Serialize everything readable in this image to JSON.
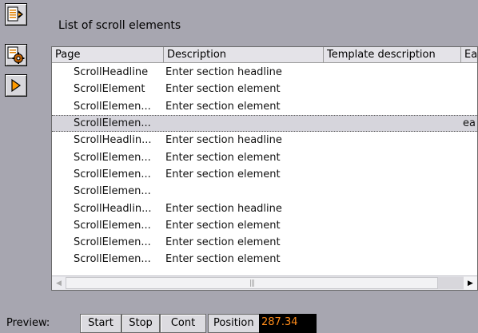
{
  "panel": {
    "title": "List of scroll elements"
  },
  "toolbar": {
    "icons": [
      "document-arrow-icon",
      "settings-gear-icon",
      "play-icon"
    ]
  },
  "grid": {
    "columns": [
      "Page",
      "Description",
      "Template description",
      "Ea"
    ],
    "rows": [
      {
        "page": "ScrollHeadline",
        "description": "Enter section headline",
        "template": "",
        "extra": ""
      },
      {
        "page": "ScrollElement",
        "description": "Enter section element",
        "template": "",
        "extra": ""
      },
      {
        "page": "ScrollElemen...",
        "description": "Enter section element",
        "template": "",
        "extra": ""
      },
      {
        "page": "ScrollElemen...",
        "description": "",
        "template": "",
        "extra": "ea"
      },
      {
        "page": "ScrollHeadlin...",
        "description": "Enter section headline",
        "template": "",
        "extra": ""
      },
      {
        "page": "ScrollElemen...",
        "description": "Enter section element",
        "template": "",
        "extra": ""
      },
      {
        "page": "ScrollElemen...",
        "description": "Enter section element",
        "template": "",
        "extra": ""
      },
      {
        "page": "ScrollElemen...",
        "description": "",
        "template": "",
        "extra": ""
      },
      {
        "page": "ScrollHeadlin...",
        "description": "Enter section headline",
        "template": "",
        "extra": ""
      },
      {
        "page": "ScrollElemen...",
        "description": "Enter section element",
        "template": "",
        "extra": ""
      },
      {
        "page": "ScrollElemen...",
        "description": "Enter section element",
        "template": "",
        "extra": ""
      },
      {
        "page": "ScrollElemen...",
        "description": "Enter section element",
        "template": "",
        "extra": ""
      }
    ],
    "selected_index": 3
  },
  "preview": {
    "label": "Preview:",
    "start": "Start",
    "stop": "Stop",
    "cont": "Cont",
    "position_label": "Position",
    "position_value": "287.34"
  },
  "colors": {
    "background": "#a7a6b0",
    "position_text": "#ff8c1a",
    "play_icon": "#ff9a00"
  }
}
